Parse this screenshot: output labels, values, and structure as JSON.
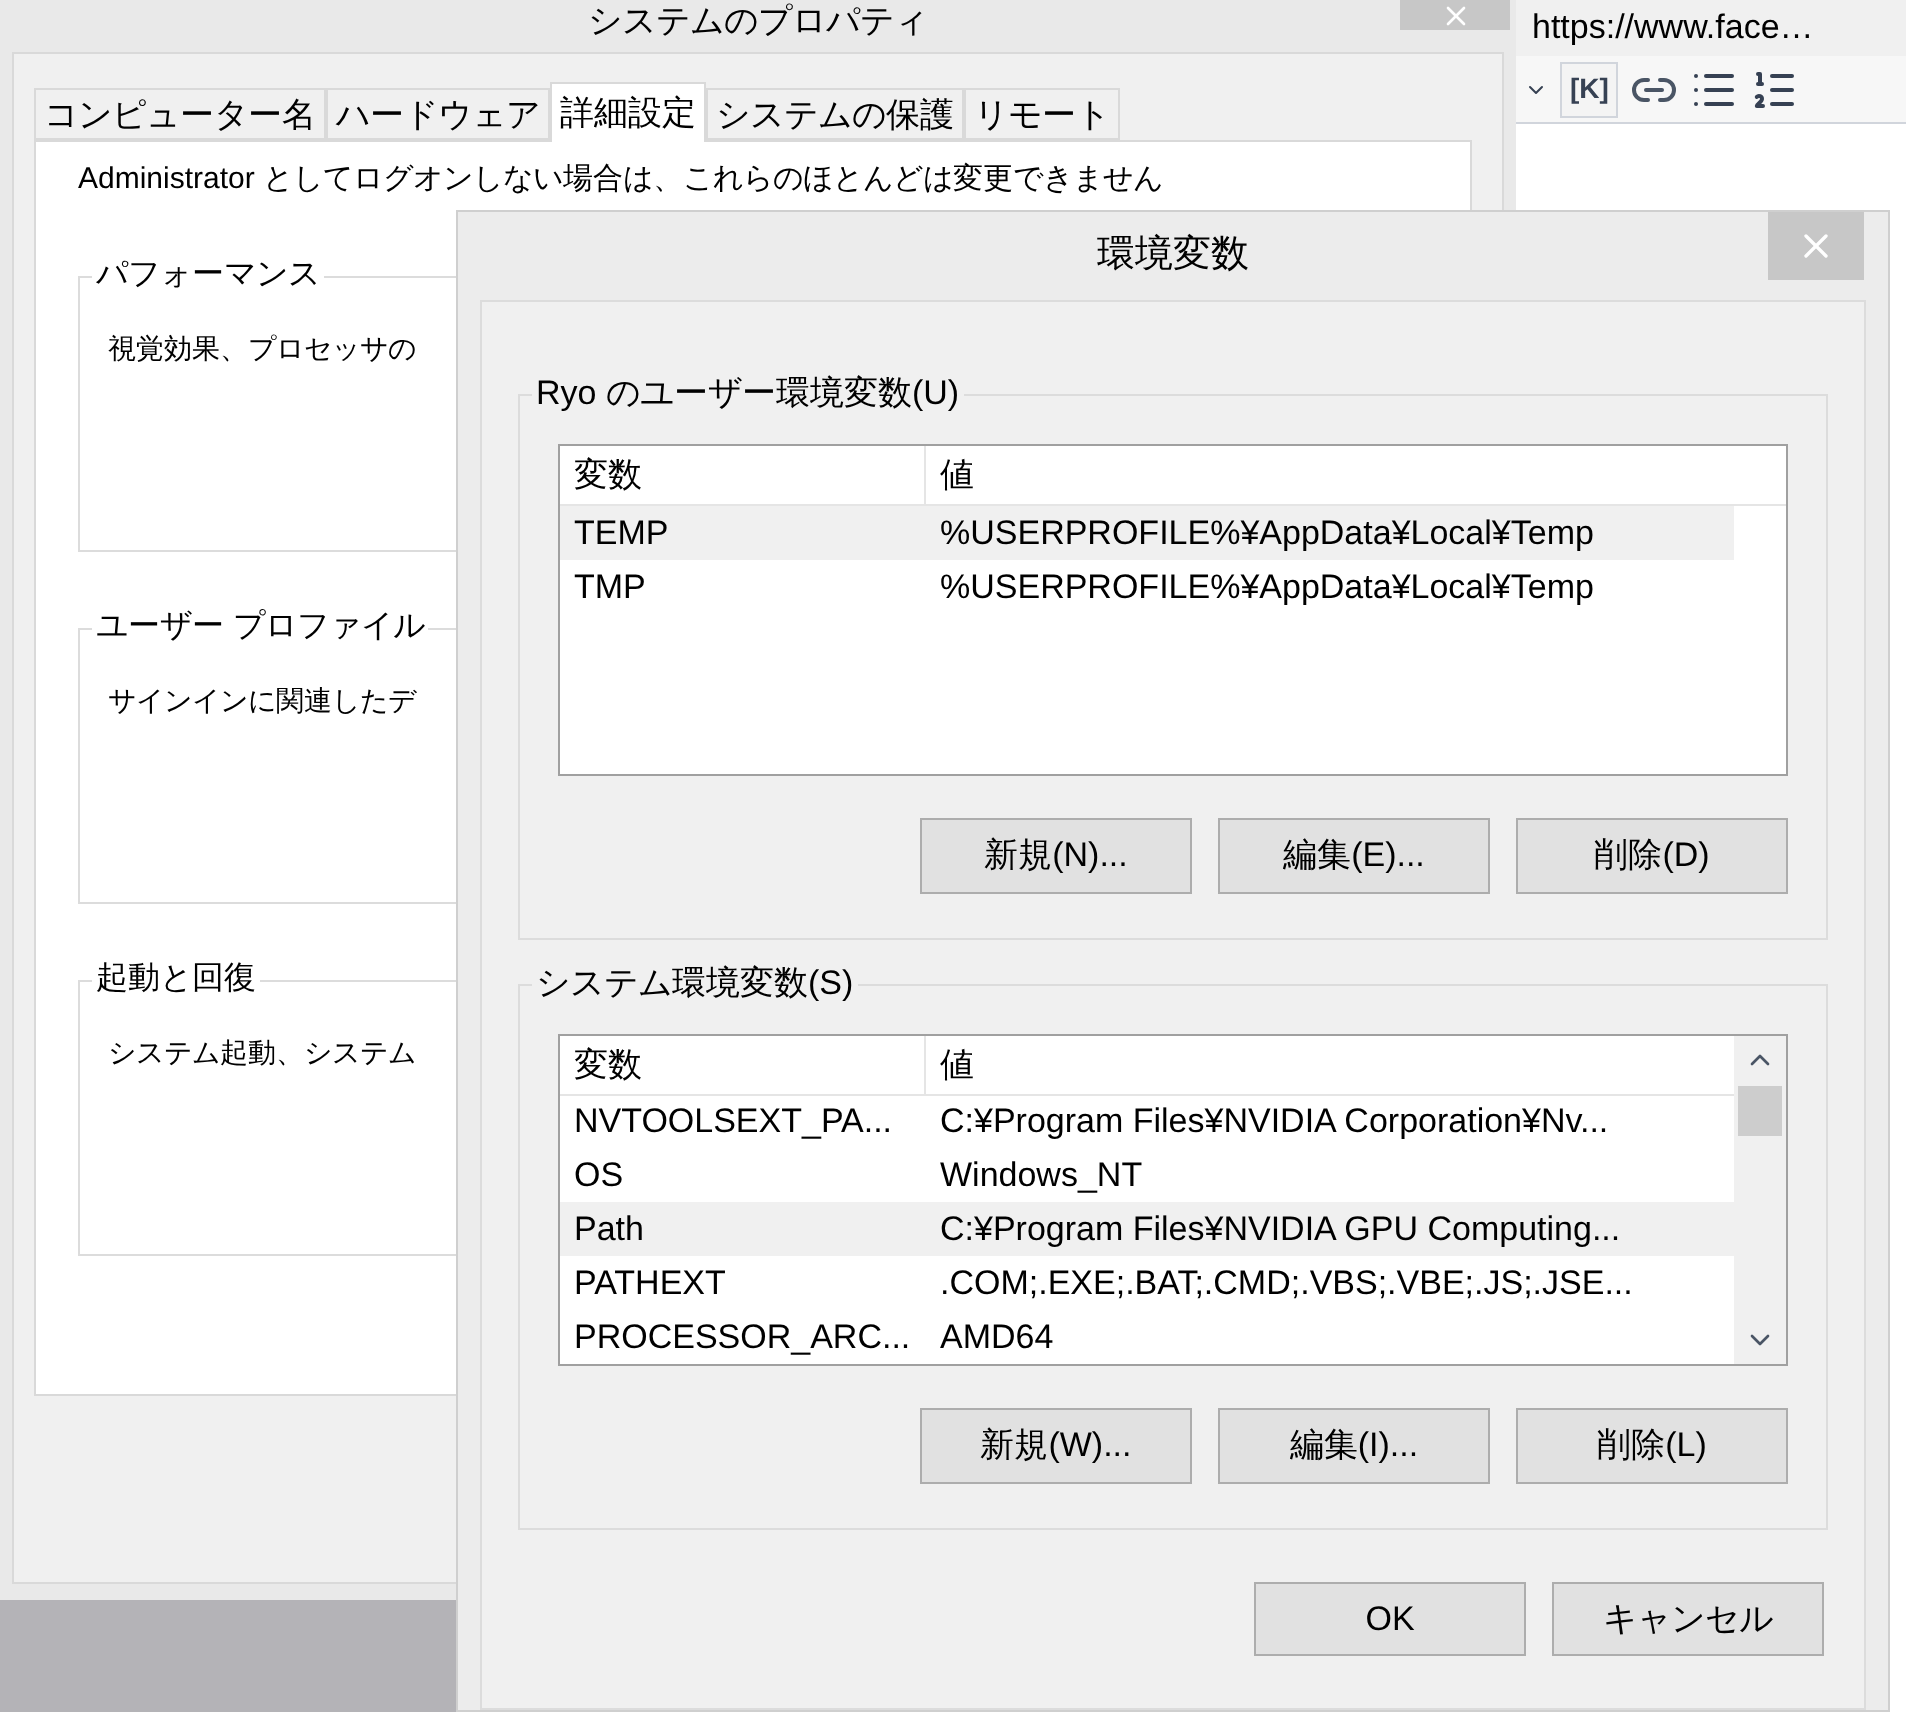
{
  "browser": {
    "url": "https://www.face…",
    "toolbar": [
      {
        "kind": "caret"
      },
      {
        "kind": "text",
        "label": "[K]"
      },
      {
        "kind": "link"
      },
      {
        "kind": "list"
      },
      {
        "kind": "numbered"
      }
    ]
  },
  "properties": {
    "title": "システムのプロパティ",
    "tabs": [
      {
        "label": "コンピューター名",
        "selected": false
      },
      {
        "label": "ハードウェア",
        "selected": false
      },
      {
        "label": "詳細設定",
        "selected": true
      },
      {
        "label": "システムの保護",
        "selected": false
      },
      {
        "label": "リモート",
        "selected": false
      }
    ],
    "notice": "Administrator としてログオンしない場合は、これらのほとんどは変更できません",
    "groups": [
      {
        "title": "パフォーマンス",
        "description": "視覚効果、プロセッサの"
      },
      {
        "title": "ユーザー プロファイル",
        "description": "サインインに関連したデ"
      },
      {
        "title": "起動と回復",
        "description": "システム起動、システム"
      }
    ]
  },
  "dialog": {
    "title": "環境変数",
    "sections": [
      {
        "title": "Ryo のユーザー環境変数(U)",
        "columns": [
          "変数",
          "値"
        ],
        "scrollbar": false,
        "rows": [
          {
            "name": "TEMP",
            "value": "%USERPROFILE%¥AppData¥Local¥Temp",
            "selected": true
          },
          {
            "name": "TMP",
            "value": "%USERPROFILE%¥AppData¥Local¥Temp",
            "selected": false
          }
        ],
        "buttons": [
          "新規(N)...",
          "編集(E)...",
          "削除(D)"
        ]
      },
      {
        "title": "システム環境変数(S)",
        "columns": [
          "変数",
          "値"
        ],
        "scrollbar": true,
        "rows": [
          {
            "name": "NVTOOLSEXT_PA...",
            "value": "C:¥Program Files¥NVIDIA Corporation¥Nv...",
            "selected": false
          },
          {
            "name": "OS",
            "value": "Windows_NT",
            "selected": false
          },
          {
            "name": "Path",
            "value": "C:¥Program Files¥NVIDIA GPU Computing...",
            "selected": true
          },
          {
            "name": "PATHEXT",
            "value": ".COM;.EXE;.BAT;.CMD;.VBS;.VBE;.JS;.JSE...",
            "selected": false
          },
          {
            "name": "PROCESSOR_ARC...",
            "value": "AMD64",
            "selected": false
          }
        ],
        "buttons": [
          "新規(W)...",
          "編集(I)...",
          "削除(L)"
        ]
      }
    ],
    "buttons": [
      "OK",
      "キャンセル"
    ]
  }
}
